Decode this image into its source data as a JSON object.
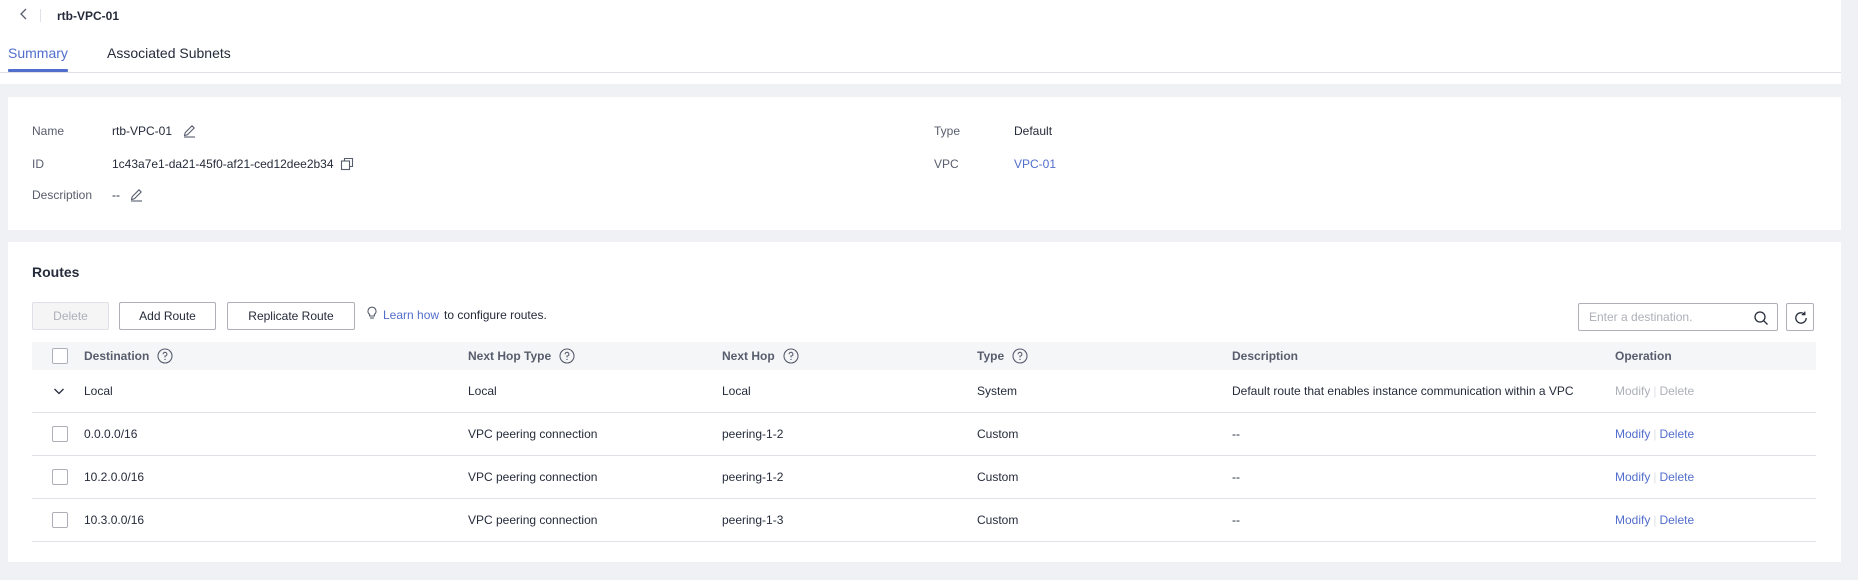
{
  "header": {
    "title": "rtb-VPC-01"
  },
  "tabs": [
    {
      "label": "Summary",
      "active": true
    },
    {
      "label": "Associated Subnets",
      "active": false
    }
  ],
  "summary": {
    "name_label": "Name",
    "name_value": "rtb-VPC-01",
    "id_label": "ID",
    "id_value": "1c43a7e1-da21-45f0-af21-ced12dee2b34",
    "description_label": "Description",
    "description_value": "--",
    "type_label": "Type",
    "type_value": "Default",
    "vpc_label": "VPC",
    "vpc_value": "VPC-01"
  },
  "routes": {
    "title": "Routes",
    "delete_label": "Delete",
    "add_label": "Add Route",
    "replicate_label": "Replicate Route",
    "tip_link": "Learn how",
    "tip_text": "to configure routes.",
    "search_placeholder": "Enter a destination.",
    "columns": {
      "destination": "Destination",
      "next_hop_type": "Next Hop Type",
      "next_hop": "Next Hop",
      "type": "Type",
      "description": "Description",
      "operation": "Operation"
    },
    "rows": [
      {
        "destination": "Local",
        "next_hop_type": "Local",
        "next_hop": "Local",
        "type": "System",
        "description": "Default route that enables instance communication within a VPC",
        "modify": "Modify",
        "delete": "Delete"
      },
      {
        "destination": "0.0.0.0/16",
        "next_hop_type": "VPC peering connection",
        "next_hop": "peering-1-2",
        "type": "Custom",
        "description": "--",
        "modify": "Modify",
        "delete": "Delete"
      },
      {
        "destination": "10.2.0.0/16",
        "next_hop_type": "VPC peering connection",
        "next_hop": "peering-1-2",
        "type": "Custom",
        "description": "--",
        "modify": "Modify",
        "delete": "Delete"
      },
      {
        "destination": "10.3.0.0/16",
        "next_hop_type": "VPC peering connection",
        "next_hop": "peering-1-3",
        "type": "Custom",
        "description": "--",
        "modify": "Modify",
        "delete": "Delete"
      }
    ]
  },
  "colors": {
    "accent": "#526ecc",
    "text": "#252b3a",
    "muted": "#575d6c",
    "disabled": "#adb0b8",
    "border": "#dfe1e6",
    "background": "#f0f1f5"
  }
}
